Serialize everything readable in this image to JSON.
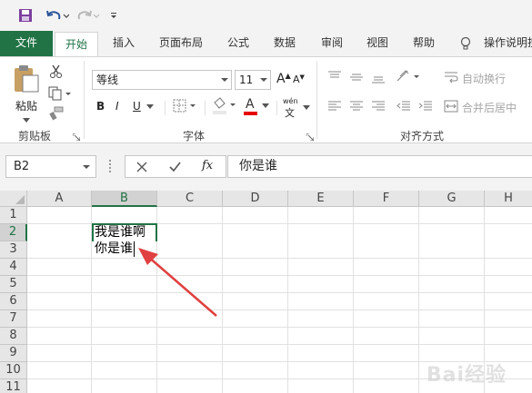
{
  "colors": {
    "accent": "#217346",
    "font_color_red": "#e60000",
    "arrow_red": "#e04040"
  },
  "ribbon_tabs": [
    {
      "label": "文件"
    },
    {
      "label": "开始"
    },
    {
      "label": "插入"
    },
    {
      "label": "页面布局"
    },
    {
      "label": "公式"
    },
    {
      "label": "数据"
    },
    {
      "label": "审阅"
    },
    {
      "label": "视图"
    },
    {
      "label": "帮助"
    },
    {
      "label": "操作说明搜"
    }
  ],
  "clipboard": {
    "paste_label": "粘贴",
    "group_label": "剪贴板"
  },
  "font": {
    "name": "等线",
    "size": "11",
    "group_label": "字体",
    "bold": "B",
    "italic": "I",
    "underline": "U",
    "grow": "A",
    "shrink": "A",
    "font_color": "A",
    "phonetic": "wén"
  },
  "alignment": {
    "wrap_text": "自动换行",
    "merge_center": "合并后居中",
    "group_label": "对齐方式"
  },
  "formula_bar": {
    "name_box": "B2",
    "fx": "fx",
    "content": "你是谁"
  },
  "sheet": {
    "columns": [
      "A",
      "B",
      "C",
      "D",
      "E",
      "F",
      "G",
      "H"
    ],
    "rows": [
      "1",
      "2",
      "3",
      "4",
      "5",
      "6",
      "7",
      "8",
      "9",
      "10",
      "11"
    ],
    "active_cell": "B2",
    "cell_line_1": "我是谁啊",
    "cell_line_2": "你是谁"
  },
  "watermark": "Bai经验"
}
